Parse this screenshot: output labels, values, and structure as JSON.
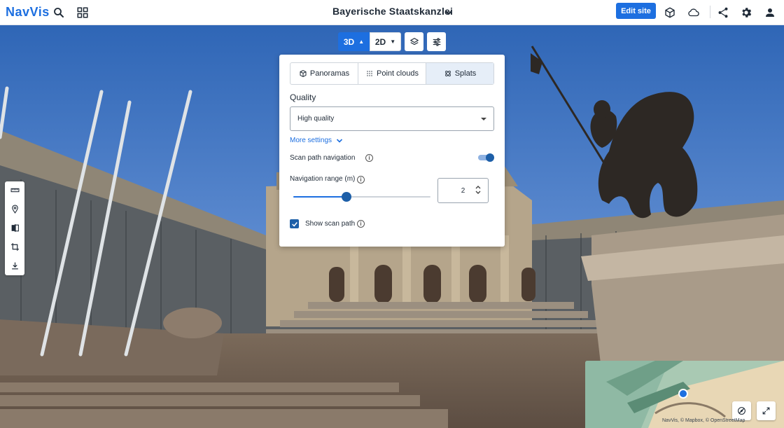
{
  "header": {
    "logo": "NavVis",
    "site_title": "Bayerische Staatskanzlei",
    "edit_label": "Edit site",
    "icons": [
      "search-icon",
      "grid-icon",
      "chevron-down-icon",
      "cube-icon",
      "cloud-icon",
      "share-icon",
      "gear-icon",
      "user-icon"
    ]
  },
  "view_controls": {
    "mode_3d": "3D",
    "mode_2d": "2D",
    "active_mode": "3D",
    "icons": [
      "layers-icon",
      "sliders-icon"
    ]
  },
  "settings_panel": {
    "tabs": [
      {
        "label": "Panoramas",
        "icon": "panorama-icon",
        "active": false
      },
      {
        "label": "Point clouds",
        "icon": "point-cloud-icon",
        "active": false
      },
      {
        "label": "Splats",
        "icon": "splats-icon",
        "active": true
      }
    ],
    "quality": {
      "label": "Quality",
      "selected": "High quality"
    },
    "more_settings": "More settings",
    "scan_path_navigation": {
      "label": "Scan path navigation",
      "enabled": true
    },
    "navigation_range": {
      "label": "Navigation range (m)",
      "value": "2",
      "slider_fraction": 0.39
    },
    "show_scan_path": {
      "label": "Show scan path",
      "checked": true
    }
  },
  "left_toolbar": {
    "icons": [
      "measure-ruler-icon",
      "location-pin-icon",
      "compare-icon",
      "crop-icon",
      "download-icon"
    ]
  },
  "minimap": {
    "attribution": "NavVis, © Mapbox, © OpenStreetMap",
    "icons": [
      "compass-icon",
      "expand-icon"
    ]
  },
  "colors": {
    "accent": "#1d6fe0",
    "dark_accent": "#1d5fa8",
    "tab_active": "#e6eef8"
  }
}
